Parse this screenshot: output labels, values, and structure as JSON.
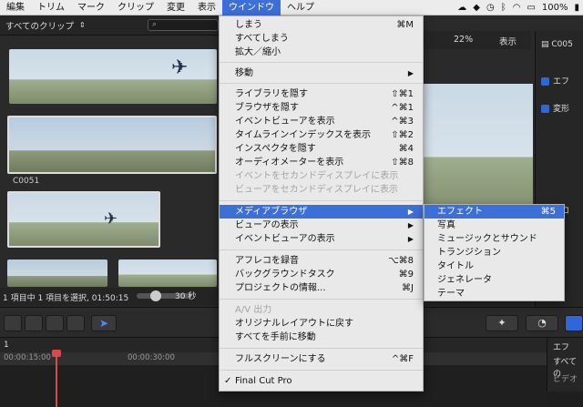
{
  "menubar": {
    "items": [
      {
        "label": "編集"
      },
      {
        "label": "トリム"
      },
      {
        "label": "マーク"
      },
      {
        "label": "クリップ"
      },
      {
        "label": "変更"
      },
      {
        "label": "表示"
      },
      {
        "label": "ウインドウ"
      },
      {
        "label": "ヘルプ"
      }
    ],
    "active_index": 6,
    "battery": "100%",
    "status_icons": [
      "creative-cloud-icon",
      "dropbox-icon",
      "time-machine-icon",
      "bluetooth-icon",
      "wifi-icon",
      "airplay-icon"
    ]
  },
  "browser": {
    "title": "すべてのクリップ",
    "clip_label": "C0051",
    "footer": "1 項目中 1 項目を選択, 01:50:15",
    "zoom": "30 秒"
  },
  "viewer": {
    "zoom": "22%",
    "display_menu": "表示",
    "clip_name": "C005"
  },
  "inspector": {
    "rows": [
      {
        "label": "エフ"
      },
      {
        "label": "変形"
      },
      {
        "label": "クロ"
      }
    ]
  },
  "timeline": {
    "index": "1",
    "timecodes": [
      "00:00:15:00",
      "00:00:30:00"
    ],
    "effects_header": "エフ",
    "effects_sub": "すべての",
    "effects_sub2": "ビデオ"
  },
  "window_menu": {
    "items": [
      {
        "label": "しまう",
        "shortcut": "⌘M"
      },
      {
        "label": "すべてしまう",
        "shortcut": ""
      },
      {
        "label": "拡大／縮小",
        "shortcut": ""
      },
      {
        "label": "移動",
        "shortcut": ""
      },
      {
        "label": "ライブラリを隠す",
        "shortcut": "⇧⌘1"
      },
      {
        "label": "ブラウザを隠す",
        "shortcut": "^⌘1"
      },
      {
        "label": "イベントビューアを表示",
        "shortcut": "^⌘3"
      },
      {
        "label": "タイムラインインデックスを表示",
        "shortcut": "⇧⌘2"
      },
      {
        "label": "インスペクタを隠す",
        "shortcut": "⌘4"
      },
      {
        "label": "オーディオメーターを表示",
        "shortcut": "⇧⌘8"
      },
      {
        "label": "イベントをセカンドディスプレイに表示",
        "shortcut": ""
      },
      {
        "label": "ビューアをセカンドディスプレイに表示",
        "shortcut": ""
      },
      {
        "label": "メディアブラウザ",
        "shortcut": ""
      },
      {
        "label": "ビューアの表示",
        "shortcut": ""
      },
      {
        "label": "イベントビューアの表示",
        "shortcut": ""
      },
      {
        "label": "アフレコを録音",
        "shortcut": "⌥⌘8"
      },
      {
        "label": "バックグラウンドタスク",
        "shortcut": "⌘9"
      },
      {
        "label": "プロジェクトの情報...",
        "shortcut": "⌘J"
      },
      {
        "label": "A/V 出力",
        "shortcut": ""
      },
      {
        "label": "オリジナルレイアウトに戻す",
        "shortcut": ""
      },
      {
        "label": "すべてを手前に移動",
        "shortcut": ""
      },
      {
        "label": "フルスクリーンにする",
        "shortcut": "^⌘F"
      },
      {
        "label": "Final Cut Pro",
        "shortcut": ""
      }
    ]
  },
  "submenu": {
    "items": [
      {
        "label": "エフェクト",
        "shortcut": "⌘5"
      },
      {
        "label": "写真",
        "shortcut": ""
      },
      {
        "label": "ミュージックとサウンド",
        "shortcut": ""
      },
      {
        "label": "トランジション",
        "shortcut": ""
      },
      {
        "label": "タイトル",
        "shortcut": ""
      },
      {
        "label": "ジェネレータ",
        "shortcut": ""
      },
      {
        "label": "テーマ",
        "shortcut": ""
      }
    ]
  },
  "colors": {
    "menu_highlight": "#3d6fd8",
    "menu_bg": "#e9e9e9",
    "app_bg": "#2a2a2a",
    "playhead": "#d64a4a"
  }
}
